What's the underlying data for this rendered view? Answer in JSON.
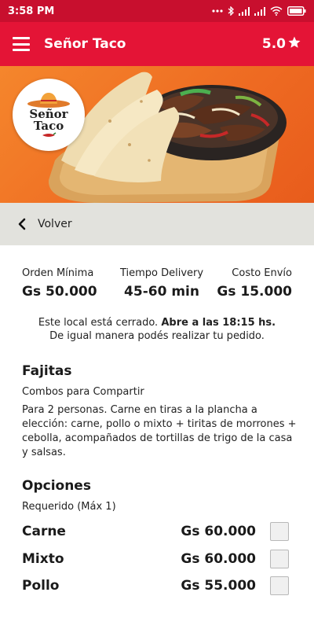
{
  "status_bar": {
    "time": "3:58 PM",
    "icons": [
      "more-dots-icon",
      "bluetooth-icon",
      "signal-icon",
      "signal-icon",
      "wifi-icon",
      "battery-icon"
    ]
  },
  "app_bar": {
    "title": "Señor Taco",
    "rating": "5.0",
    "brand_color": "#e41436"
  },
  "hero": {
    "logo_line1": "Señor",
    "logo_line2": "Taco",
    "background_color": "#f07424"
  },
  "back": {
    "label": "Volver"
  },
  "stats": [
    {
      "label": "Orden Mínima",
      "value": "Gs 50.000"
    },
    {
      "label": "Tiempo Delivery",
      "value": "45-60 min"
    },
    {
      "label": "Costo Envío",
      "value": "Gs 15.000"
    }
  ],
  "notice": {
    "text1": "Este local está cerrado. ",
    "bold": "Abre a las 18:15 hs.",
    "text2": "De igual manera podés realizar tu pedido."
  },
  "product": {
    "title": "Fajitas",
    "category": "Combos para Compartir",
    "description": "Para 2 personas. Carne en tiras a la plancha a elección: carne, pollo o mixto + tiritas de morrones + cebolla, acompañados de tortillas de trigo de la casa y salsas."
  },
  "options": {
    "title": "Opciones",
    "requirement": "Requerido (Máx 1)",
    "items": [
      {
        "name": "Carne",
        "price": "Gs 60.000",
        "checked": false
      },
      {
        "name": "Mixto",
        "price": "Gs 60.000",
        "checked": false
      },
      {
        "name": "Pollo",
        "price": "Gs 55.000",
        "checked": false
      }
    ]
  }
}
